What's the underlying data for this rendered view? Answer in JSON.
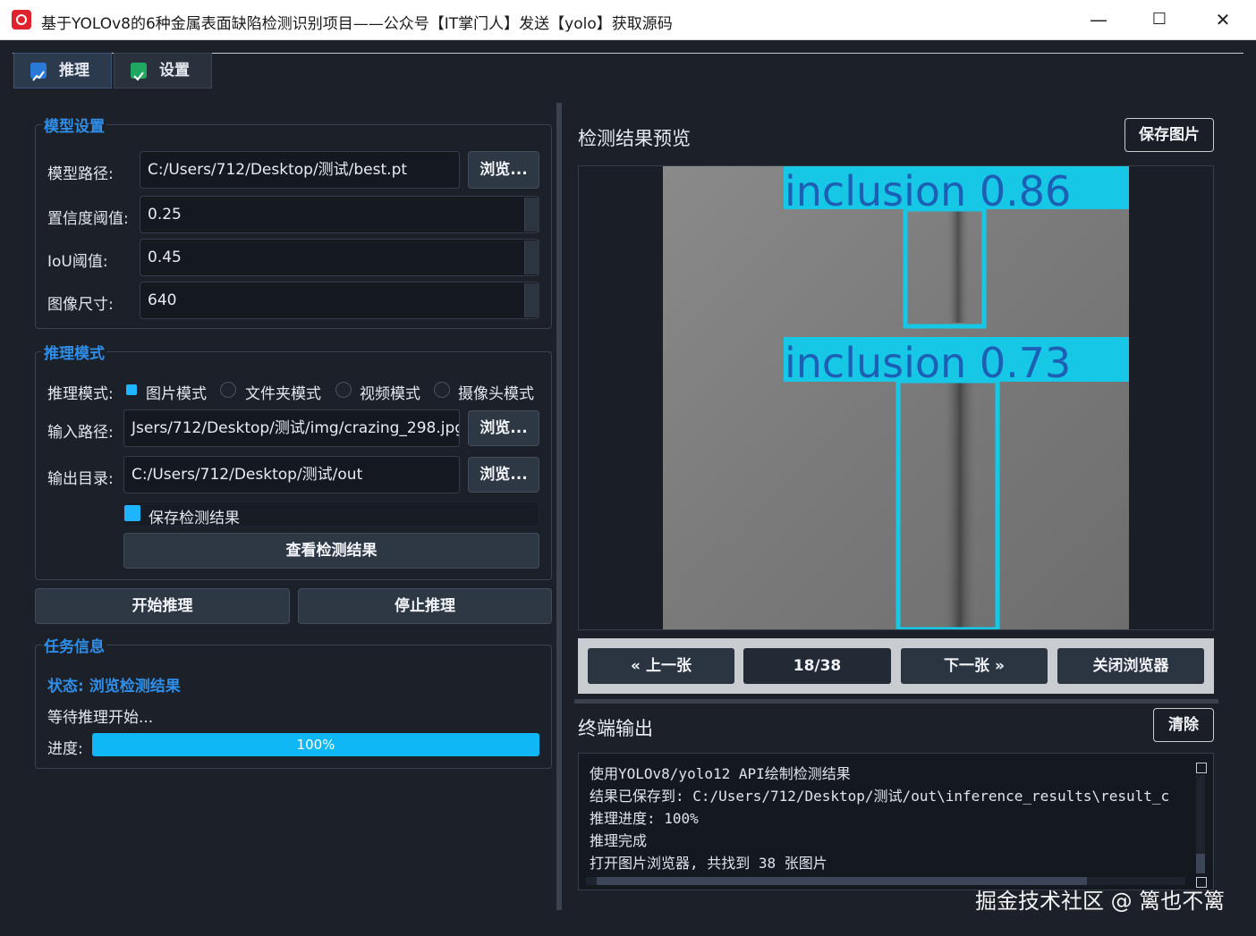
{
  "window": {
    "title": "基于YOLOv8的6种金属表面缺陷检测识别项目——公众号【IT掌门人】发送【yolo】获取源码",
    "minimize": "—",
    "maximize": "☐",
    "close": "✕"
  },
  "tabs": [
    {
      "label": "推理",
      "icon": "chart-icon"
    },
    {
      "label": "设置",
      "icon": "check-icon"
    }
  ],
  "model_settings": {
    "title": "模型设置",
    "model_path_label": "模型路径:",
    "model_path": "C:/Users/712/Desktop/测试/best.pt",
    "browse": "浏览...",
    "conf_label": "置信度阈值:",
    "conf": "0.25",
    "iou_label": "IoU阈值:",
    "iou": "0.45",
    "imgsz_label": "图像尺寸:",
    "imgsz": "640"
  },
  "inference_mode": {
    "title": "推理模式",
    "mode_label": "推理模式:",
    "modes": [
      "图片模式",
      "文件夹模式",
      "视频模式",
      "摄像头模式"
    ],
    "selected": "图片模式",
    "input_label": "输入路径:",
    "input_path": "Jsers/712/Desktop/测试/img/crazing_298.jpg",
    "output_label": "输出目录:",
    "output_path": "C:/Users/712/Desktop/测试/out",
    "browse": "浏览...",
    "save_results": "保存检测结果",
    "view_results": "查看检测结果"
  },
  "actions": {
    "start": "开始推理",
    "stop": "停止推理"
  },
  "task_info": {
    "title": "任务信息",
    "status": "状态: 浏览检测结果",
    "message": "等待推理开始...",
    "progress_label": "进度:",
    "progress_text": "100%",
    "progress_value": 100
  },
  "preview": {
    "title": "检测结果预览",
    "save_button": "保存图片",
    "detections": [
      {
        "label": "inclusion  0.86"
      },
      {
        "label": "inclusion  0.73"
      }
    ],
    "colors": {
      "box": "#17c8e6",
      "label_bg": "#17c8e6",
      "label_text": "#1d5fb4"
    }
  },
  "navigation": {
    "prev": "« 上一张",
    "counter": "18/38",
    "next": "下一张 »",
    "close": "关闭浏览器"
  },
  "terminal": {
    "title": "终端输出",
    "clear": "清除",
    "lines": [
      "使用YOLOv8/yolo12 API绘制检测结果",
      "结果已保存到: C:/Users/712/Desktop/测试/out\\inference_results\\result_c",
      "推理进度: 100%",
      "推理完成",
      "打开图片浏览器, 共找到 38 张图片"
    ]
  },
  "watermark": "掘金技术社区 @ 篱也不篱"
}
